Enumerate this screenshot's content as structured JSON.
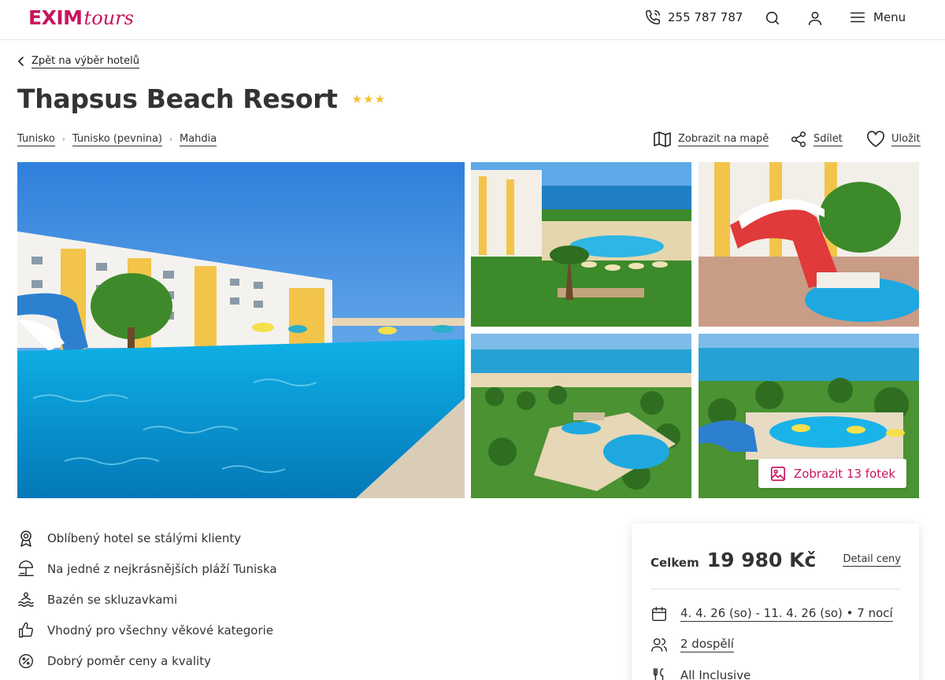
{
  "header": {
    "logo_main": "EXIM",
    "logo_sub": "tours",
    "phone": "255 787 787",
    "menu_label": "Menu",
    "brand_color": "#c8145f"
  },
  "back_link": "Zpět na výběr hotelů",
  "hotel": {
    "name": "Thapsus Beach Resort",
    "stars_text": "★★★",
    "star_rating": 3
  },
  "breadcrumb": [
    "Tunisko",
    "Tunisko (pevnina)",
    "Mahdia"
  ],
  "actions": {
    "map": "Zobrazit na mapě",
    "share": "Sdílet",
    "save": "Uložit"
  },
  "gallery": {
    "show_photos": "Zobrazit 13 fotek"
  },
  "features": [
    {
      "icon": "award-icon",
      "label": "Oblíbený hotel se stálými klienty"
    },
    {
      "icon": "beach-umbrella-icon",
      "label": "Na jedné z nejkrásnějších pláží Tuniska"
    },
    {
      "icon": "swimmer-icon",
      "label": "Bazén se skluzavkami"
    },
    {
      "icon": "thumbs-up-icon",
      "label": "Vhodný pro všechny věkové kategorie"
    },
    {
      "icon": "discount-icon",
      "label": "Dobrý poměr ceny a kvality"
    }
  ],
  "price_card": {
    "total_label": "Celkem",
    "total_value": "19 980 Kč",
    "detail_link": "Detail ceny",
    "dates": "4. 4. 26 (so) - 11. 4. 26 (so) • 7 nocí",
    "travelers": "2 dospělí",
    "board": "All Inclusive"
  }
}
